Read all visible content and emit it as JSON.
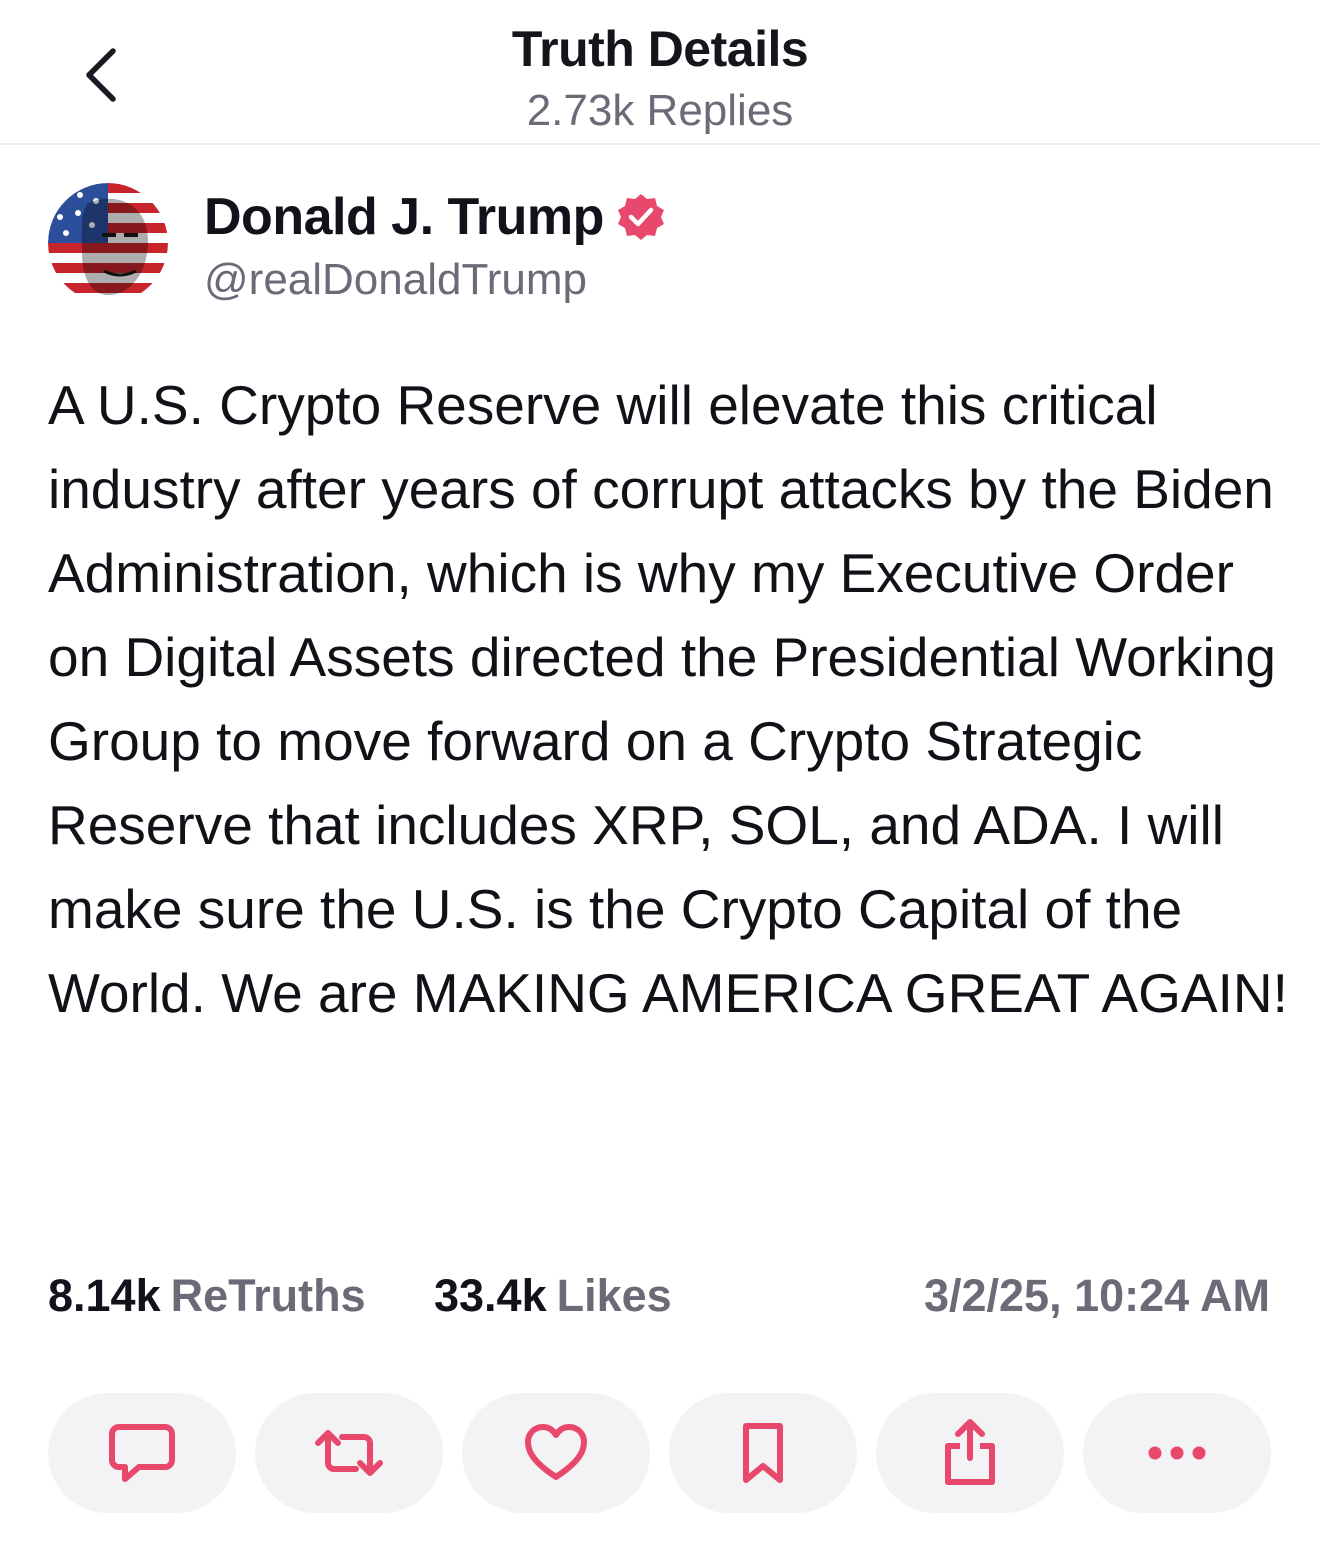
{
  "header": {
    "title": "Truth Details",
    "subtitle": "2.73k Replies",
    "back_icon": "chevron-left-icon"
  },
  "author": {
    "name": "Donald J. Trump",
    "handle": "@realDonaldTrump",
    "verified": true,
    "verified_color": "#e9486d"
  },
  "post": {
    "text": "A U.S. Crypto Reserve will elevate this critical industry after years of corrupt attacks by the Biden Administration, which is why my Executive Order on Digital Assets directed the Presidential Working Group to move forward on a Crypto Strategic Reserve that includes XRP, SOL, and ADA. I will make sure the U.S. is the Crypto Capital of the World. We are MAKING AMERICA GREAT AGAIN!"
  },
  "stats": {
    "retruths_count": "8.14k",
    "retruths_label": "ReTruths",
    "likes_count": "33.4k",
    "likes_label": "Likes",
    "timestamp": "3/2/25, 10:24 AM"
  },
  "actions": [
    {
      "name": "reply-button",
      "icon": "comment-icon"
    },
    {
      "name": "retruth-button",
      "icon": "repost-icon"
    },
    {
      "name": "like-button",
      "icon": "heart-icon"
    },
    {
      "name": "bookmark-button",
      "icon": "bookmark-icon"
    },
    {
      "name": "share-button",
      "icon": "share-icon"
    },
    {
      "name": "more-button",
      "icon": "more-horizontal-icon"
    }
  ]
}
